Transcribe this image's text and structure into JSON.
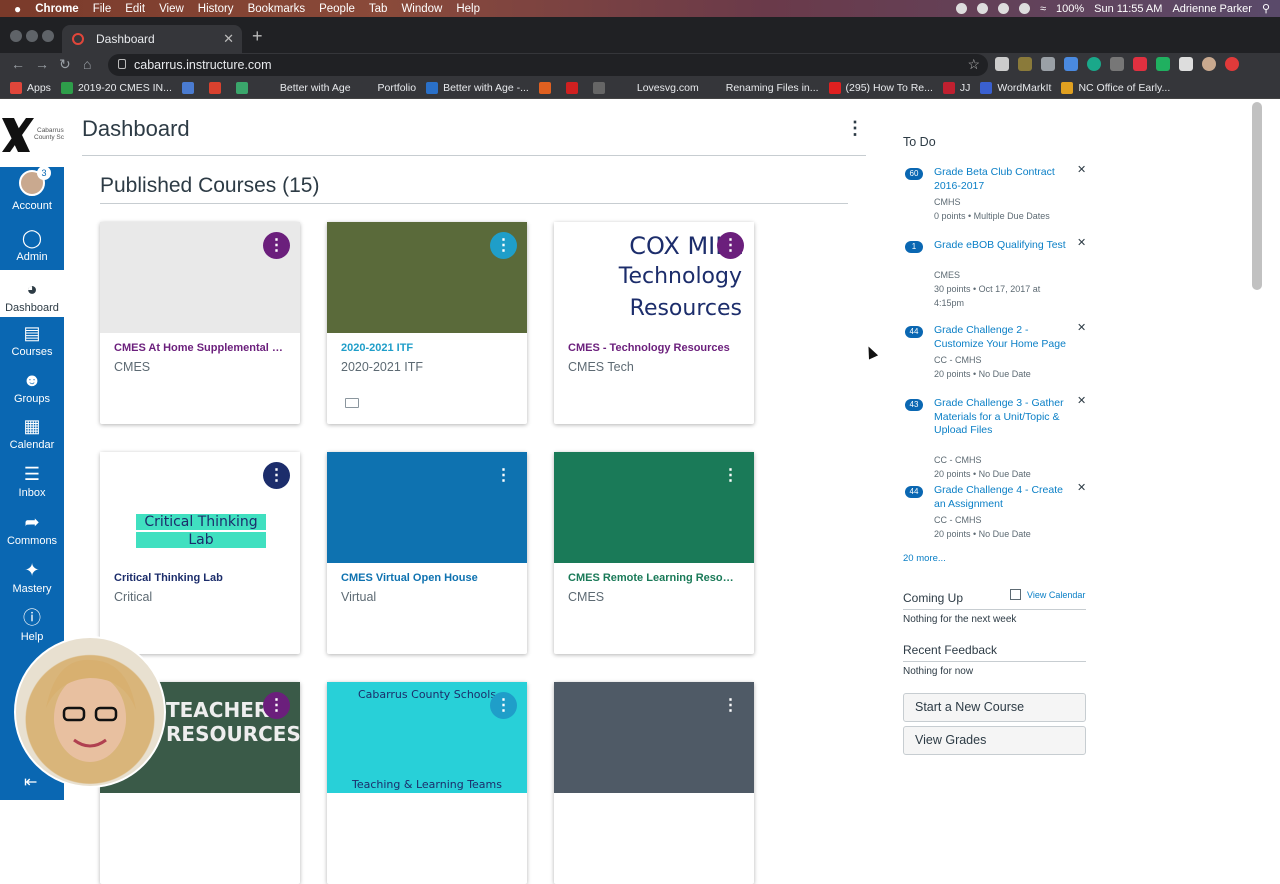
{
  "mac_menu": {
    "apple": "",
    "items": [
      "Chrome",
      "File",
      "Edit",
      "View",
      "History",
      "Bookmarks",
      "People",
      "Tab",
      "Window",
      "Help"
    ],
    "battery": "100%",
    "clock": "Sun 11:55 AM",
    "user": "Adrienne Parker"
  },
  "browser": {
    "tab_title": "Dashboard",
    "url": "cabarrus.instructure.com",
    "bookmarks": [
      {
        "label": "Apps",
        "color": "#e0463a"
      },
      {
        "label": "2019-20 CMES IN...",
        "color": "#2e9e4a"
      },
      {
        "label": "",
        "color": "#4a7bd0"
      },
      {
        "label": "",
        "color": "#d9412e"
      },
      {
        "label": "",
        "color": "#3aa66b"
      },
      {
        "label": "Better with Age",
        "color": "#35363a"
      },
      {
        "label": "Portfolio",
        "color": "#35363a"
      },
      {
        "label": "Better with Age -...",
        "color": "#2a70c8"
      },
      {
        "label": "",
        "color": "#e06020"
      },
      {
        "label": "",
        "color": "#d02020"
      },
      {
        "label": "",
        "color": "#666"
      },
      {
        "label": "Lovesvg.com",
        "color": "#35363a"
      },
      {
        "label": "Renaming Files in...",
        "color": "#35363a"
      },
      {
        "label": "(295) How To Re...",
        "color": "#e02020"
      },
      {
        "label": "JJ",
        "color": "#c02030"
      },
      {
        "label": "WordMarkIt",
        "color": "#3a60d0"
      },
      {
        "label": "NC Office of Early...",
        "color": "#e0a020"
      }
    ]
  },
  "nav": {
    "account_badge": "3",
    "items": {
      "account": "Account",
      "admin": "Admin",
      "dashboard": "Dashboard",
      "courses": "Courses",
      "groups": "Groups",
      "calendar": "Calendar",
      "inbox": "Inbox",
      "commons": "Commons",
      "mastery": "Mastery",
      "help": "Help"
    },
    "logo_text": "Cabarrus County Schools"
  },
  "page": {
    "title": "Dashboard",
    "section_heading": "Published Courses (15)"
  },
  "cards": [
    {
      "title": "CMES At Home Supplemental Res...",
      "sub": "CMES",
      "color": "#6b1f7c",
      "hero": "#e9e9e9",
      "kebab": "#6b1f7c"
    },
    {
      "title": "2020-2021 ITF",
      "sub": "2020-2021 ITF",
      "color": "#1f9ec9",
      "hero": "#5a6a3a",
      "kebab": "#1f9ec9"
    },
    {
      "title": "CMES - Technology Resources",
      "sub": "CMES Tech",
      "color": "#6b1f7c",
      "hero": "#ffffff",
      "kebab": "#6b1f7c",
      "hero_text": [
        "COX MILL",
        "Technology",
        "Resources"
      ]
    },
    {
      "title": "Critical Thinking Lab",
      "sub": "Critical",
      "color": "#1c2d6b",
      "hero": "#ffffff",
      "kebab": "#1c2d6b",
      "hero_text": [
        "Critical Thinking",
        "Lab"
      ]
    },
    {
      "title": "CMES Virtual Open House",
      "sub": "Virtual",
      "color": "#0e72b0",
      "hero": "#0e72b0",
      "kebab": "#0e72b0"
    },
    {
      "title": "CMES Remote Learning Resources",
      "sub": "CMES",
      "color": "#1a7a58",
      "hero": "#1a7a58",
      "kebab": "#1a7a58"
    },
    {
      "title": "",
      "sub": "",
      "color": "#6b1f7c",
      "hero": "#3a5a48",
      "kebab": "#6b1f7c",
      "hero_text": [
        "TEACHER",
        "RESOURCES"
      ]
    },
    {
      "title": "",
      "sub": "",
      "color": "#1f9ec9",
      "hero": "#28d0d8",
      "kebab": "#1f9ec9",
      "hero_text": [
        "Cabarrus County Schools",
        "Teaching & Learning Teams"
      ]
    },
    {
      "title": "",
      "sub": "",
      "color": "#4f5a66",
      "hero": "#4f5a66",
      "kebab": "#4f5a66"
    }
  ],
  "sidebar": {
    "todo_heading": "To Do",
    "todos": [
      {
        "count": "60",
        "link": "Grade Beta Club Contract 2016-2017",
        "meta": [
          "CMHS",
          "0 points • Multiple Due Dates"
        ]
      },
      {
        "count": "1",
        "link": "Grade eBOB Qualifying Test",
        "meta": [
          "CMES",
          "30 points • Oct 17, 2017 at 4:15pm"
        ]
      },
      {
        "count": "44",
        "link": "Grade Challenge 2 - Customize Your Home Page",
        "meta": [
          "CC - CMHS",
          "20 points • No Due Date"
        ]
      },
      {
        "count": "43",
        "link": "Grade Challenge 3 - Gather Materials for a Unit/Topic & Upload Files",
        "meta": [
          "CC - CMHS",
          "20 points • No Due Date"
        ]
      },
      {
        "count": "44",
        "link": "Grade Challenge 4 - Create an Assignment",
        "meta": [
          "CC - CMHS",
          "20 points • No Due Date"
        ]
      }
    ],
    "more": "20 more...",
    "coming_up": "Coming Up",
    "view_calendar": "View Calendar",
    "coming_up_body": "Nothing for the next week",
    "feedback": "Recent Feedback",
    "feedback_body": "Nothing for now",
    "start_course": "Start a New Course",
    "view_grades": "View Grades"
  }
}
